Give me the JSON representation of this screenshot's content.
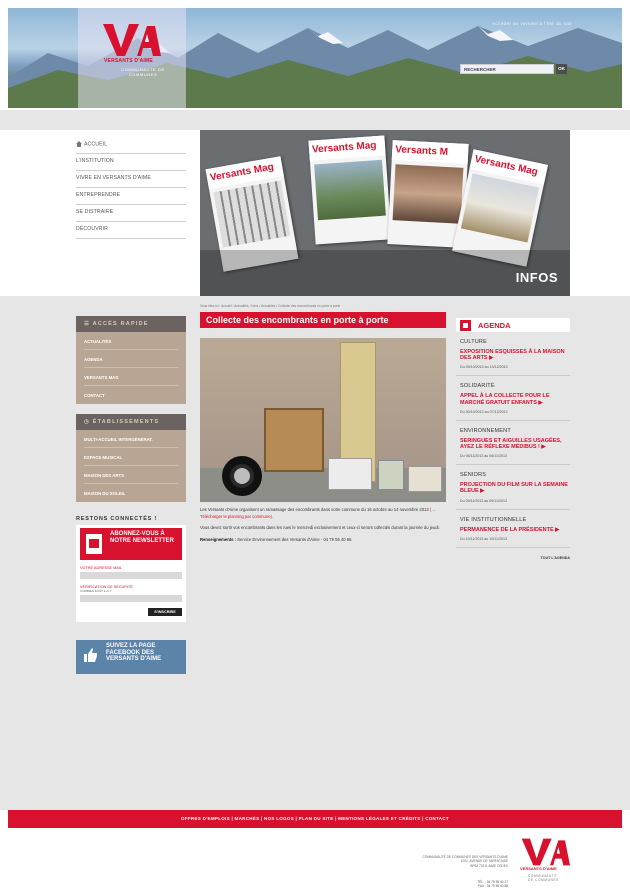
{
  "header": {
    "logo_name": "VERSANTS D'AIME",
    "logo_sub": "COMMUNAUTÉ DE COMMUNES",
    "top_link": "Accéder au versant à l'été du site",
    "search_placeholder": "RECHERCHER",
    "search_button": "OK"
  },
  "nav": {
    "items": [
      {
        "label": "ACCUEIL"
      },
      {
        "label": "L'INSTITUTION"
      },
      {
        "label": "VIVRE EN VERSANTS D'AIME"
      },
      {
        "label": "ENTREPRENDRE"
      },
      {
        "label": "SE DISTRAIRE"
      },
      {
        "label": "DÉCOUVRIR"
      }
    ]
  },
  "hero": {
    "label": "INFOS",
    "magazines": [
      "Versants Mag",
      "Versants Mag",
      "Versants M",
      "Versants Mag"
    ]
  },
  "sidebar": {
    "quick_title": "ACCÈS RAPIDE",
    "quick_links": [
      "ACTUALITÉS",
      "AGENDA",
      "VERSANTS MAG",
      "CONTACT"
    ],
    "estab_title": "ÉTABLISSEMENTS",
    "estab_links": [
      "MULTI-ACCUEIL INTERGÉNÉRAT.",
      "ESPACE MUSICAL",
      "MAISON DES ARTS",
      "MAISON DU SOLEIL"
    ],
    "restez": "RESTONS CONNECTÉS !",
    "newsletter": {
      "title": "ABONNEZ-VOUS À NOTRE NEWSLETTER",
      "email_label": "VOTRE ADRESSE MAIL",
      "security_label": "VÉRIFICATION DE SÉCURITÉ",
      "security_hint": "COMBIEN FONT 2+3 ?",
      "button": "S'INSCRIRE"
    },
    "facebook": "SUIVEZ LA PAGE FACEBOOK DES VERSANTS D'AIME"
  },
  "article": {
    "breadcrumb": "Vous êtes ici : Accueil / Actualités / Infos / Actualités / Collecte des encombrants en porte à porte",
    "title": "Collecte des encombrants en porte à porte",
    "p1": "Les Versants d'Aime organisent un ramassage des encombrants dans votre commune du 16 octobre au 14 novembre 2013",
    "p1_link": "(→ Télécharger le planning par commune).",
    "p2": "Vous devez sortir vos encombrants dans les rues le mercredi exclusivement et ceux-ci seront collectés durant la journée du jeudi.",
    "p3_label": "Renseignements :",
    "p3": "Service Environnement des Versants d'Aime - 04 79 55 40 66"
  },
  "agenda": {
    "title": "AGENDA",
    "items": [
      {
        "cat": "CULTURE",
        "title": "EXPOSITION ESQUISSES À LA MAISON DES ARTS ▶",
        "date": "Du 09/10/2013 au 13/12/2013"
      },
      {
        "cat": "SOLIDARITÉ",
        "title": "APPEL À LA COLLECTE POUR LE MARCHÉ GRATUIT ENFANTS ▶",
        "date": "Du 30/10/2013 au 07/12/2013"
      },
      {
        "cat": "ENVIRONNEMENT",
        "title": "SERINGUES ET AIGUILLES USAGÉES, AYEZ LE RÉFLEXE MÉDIBUS ! ▶",
        "date": "Du 06/11/2013 au 06/11/2013"
      },
      {
        "cat": "SÉNIORS",
        "title": "PROJECTION DU FILM SUR LA SEMAINE BLEUE ▶",
        "date": "Du 09/11/2013 au 09/11/2013"
      },
      {
        "cat": "VIE INSTITUTIONNELLE",
        "title": "PERMANENCE DE LA PRÉSIDENTE ▶",
        "date": "Du 10/11/2013 au 10/11/2013"
      }
    ],
    "all": "TOUT L'AGENDA"
  },
  "footer": {
    "links": "OFFRES D'EMPLOIS  |  MARCHÉS  |  NOS LOGOS  |  PLAN DU SITE  |  MENTIONS LÉGALES ET CRÉDITS  |  CONTACT",
    "address1": "COMMUNAUTÉ DE COMMUNES DES VERSANTS D'AIME",
    "address2": "1002, AVENUE DE TARENTAISE",
    "address3": "BP63 73211 AIME CEDEX",
    "tel": "TÉL. : 04 79 55 40 27",
    "fax": "FAX : 04 79 55 40 88",
    "logo_name": "VERSANTS D'AIME",
    "logo_sub1": "COMMUNAUTÉ",
    "logo_sub2": "DE COMMUNES"
  },
  "colors": {
    "brand_red": "#d8112e",
    "brown": "#b8a594",
    "facebook": "#5c83a8"
  }
}
